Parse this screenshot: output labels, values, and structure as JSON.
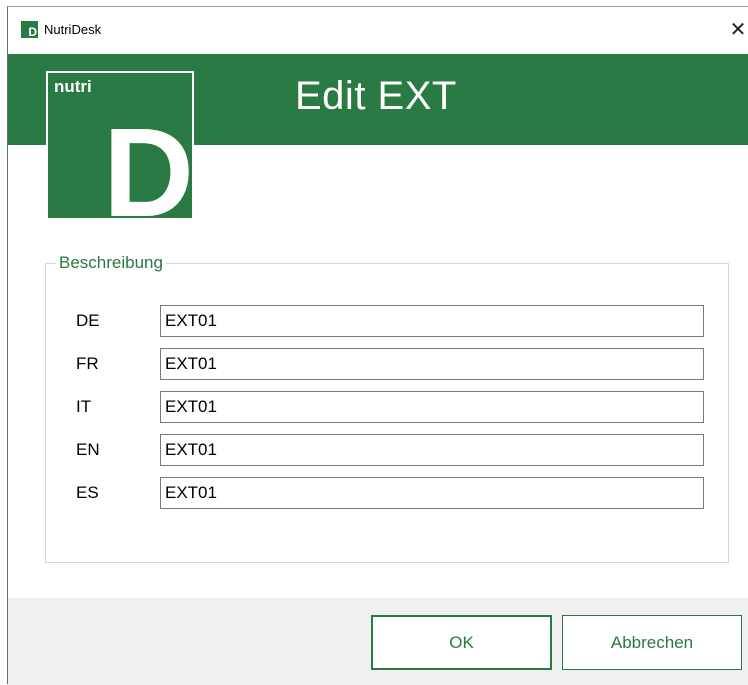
{
  "window": {
    "title": "NutriDesk",
    "close_glyph": "✕",
    "app_icon_glyph": "D"
  },
  "banner": {
    "title": "Edit EXT",
    "logo_small_text": "nutri",
    "logo_big_text": "D"
  },
  "colors": {
    "brand_green": "#2a7a43",
    "footer_bg": "#f0f0f0"
  },
  "description": {
    "legend": "Beschreibung",
    "rows": [
      {
        "label": "DE",
        "value": "EXT01"
      },
      {
        "label": "FR",
        "value": "EXT01"
      },
      {
        "label": "IT",
        "value": "EXT01"
      },
      {
        "label": "EN",
        "value": "EXT01"
      },
      {
        "label": "ES",
        "value": "EXT01"
      }
    ]
  },
  "buttons": {
    "ok_label": "OK",
    "cancel_label": "Abbrechen"
  }
}
